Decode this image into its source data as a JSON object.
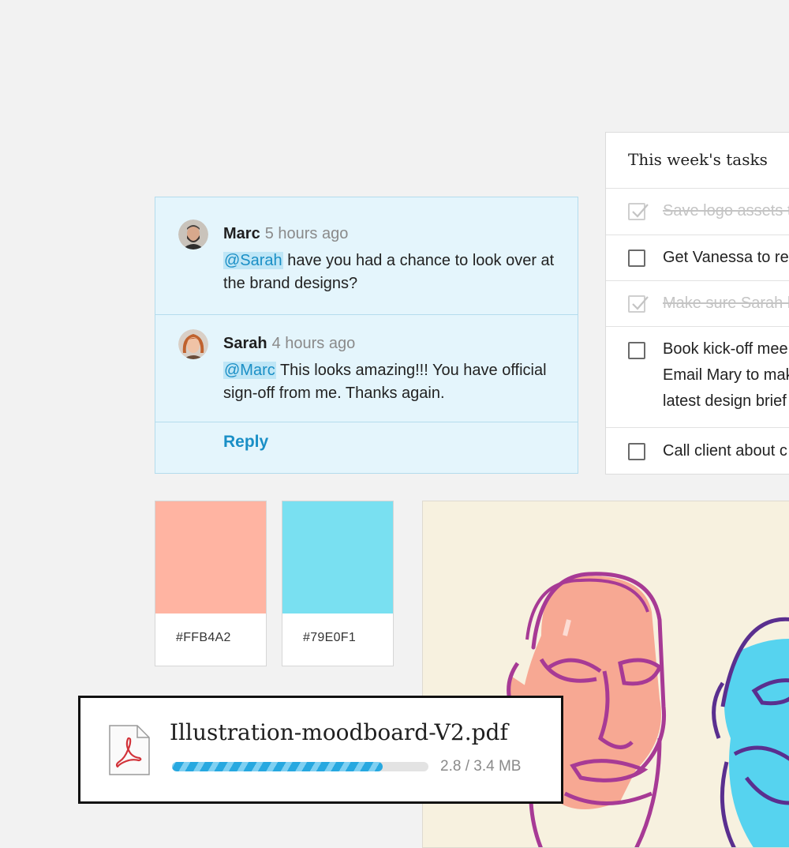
{
  "comments": [
    {
      "author": "Marc",
      "time": "5 hours ago",
      "mention": "@Sarah",
      "text": " have you had a chance to look over at the brand designs?",
      "avatar": "marc-avatar"
    },
    {
      "author": "Sarah",
      "time": "4 hours ago",
      "mention": "@Marc",
      "text": " This looks amazing!!! You have official sign-off from me. Thanks again.",
      "avatar": "sarah-avatar"
    }
  ],
  "reply_label": "Reply",
  "tasks": {
    "title": "This week's tasks",
    "items": [
      {
        "label": "Save logo assets t",
        "done": true
      },
      {
        "label": "Get Vanessa to rev",
        "done": false
      },
      {
        "label": "Make sure Sarah h",
        "done": true
      },
      {
        "label_lines": [
          "Book kick-off mee",
          "Email Mary to mak",
          "latest design brief"
        ],
        "done": false
      },
      {
        "label": "Call client about c",
        "done": false
      }
    ]
  },
  "swatches": [
    {
      "hex": "#FFB4A2",
      "color": "#FFB4A2"
    },
    {
      "hex": "#79E0F1",
      "color": "#79E0F1"
    }
  ],
  "file": {
    "name": "Illustration-moodboard-V2.pdf",
    "size_text": "2.8 / 3.4 MB",
    "progress": 0.82,
    "icon": "pdf-icon"
  },
  "colors": {
    "accent": "#1A8FC6",
    "comment_bg": "#E4F5FC",
    "progress": "#27A8E0"
  }
}
